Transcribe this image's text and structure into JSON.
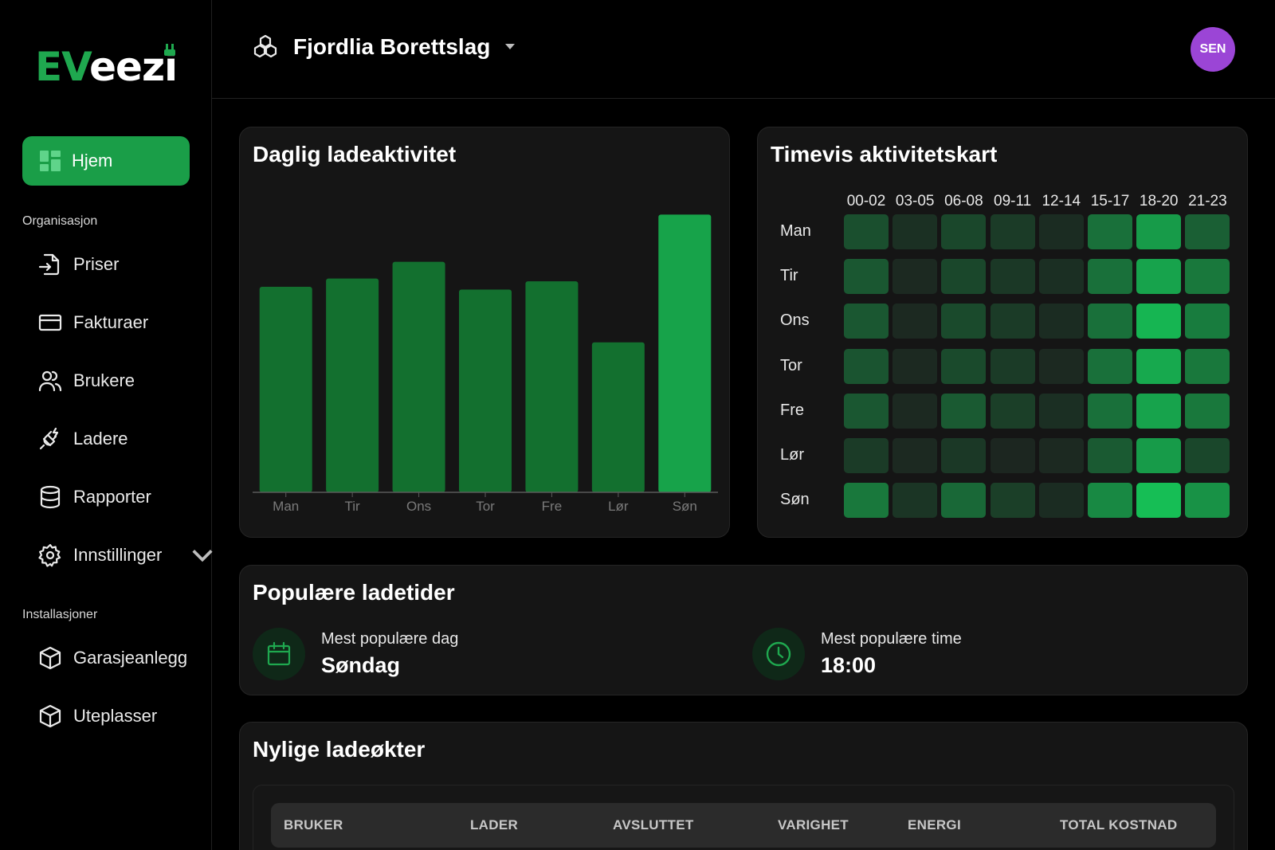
{
  "brand": {
    "logo_ev": "EV",
    "logo_eezi": "eezi",
    "accent": "#1a9e48"
  },
  "sidebar": {
    "home": {
      "label": "Hjem",
      "icon": "dashboard-icon"
    },
    "section_org": "Organisasjon",
    "org_items": [
      {
        "label": "Priser",
        "icon": "login-icon"
      },
      {
        "label": "Fakturaer",
        "icon": "credit-card-icon"
      },
      {
        "label": "Brukere",
        "icon": "users-icon"
      },
      {
        "label": "Ladere",
        "icon": "plug-icon"
      },
      {
        "label": "Rapporter",
        "icon": "database-icon"
      },
      {
        "label": "Innstillinger",
        "icon": "gear-icon"
      }
    ],
    "section_install": "Installasjoner",
    "install_items": [
      {
        "label": "Garasjeanlegg",
        "icon": "box-icon"
      },
      {
        "label": "Uteplasser",
        "icon": "box-icon"
      }
    ]
  },
  "header": {
    "org_name": "Fjordlia Borettslag",
    "avatar_initials": "SEN",
    "avatar_color": "#9b45d6"
  },
  "bar_card": {
    "title": "Daglig ladeaktivitet"
  },
  "chart_data": {
    "type": "bar",
    "categories": [
      "Man",
      "Tir",
      "Ons",
      "Tor",
      "Fre",
      "Lør",
      "Søn"
    ],
    "values": [
      74,
      77,
      83,
      73,
      76,
      54,
      100
    ],
    "ylim": [
      0,
      105
    ],
    "bar_color": "#13702f",
    "highlight_color": "#17a34a"
  },
  "heat_card": {
    "title": "Timevis aktivitetskart",
    "columns": [
      "00-02",
      "03-05",
      "06-08",
      "09-11",
      "12-14",
      "15-17",
      "18-20",
      "21-23"
    ],
    "rows": [
      "Man",
      "Tir",
      "Ons",
      "Tor",
      "Fre",
      "Lør",
      "Søn"
    ],
    "values": [
      [
        0.35,
        0.15,
        0.3,
        0.22,
        0.12,
        0.55,
        0.8,
        0.45
      ],
      [
        0.4,
        0.1,
        0.3,
        0.2,
        0.14,
        0.55,
        0.85,
        0.6
      ],
      [
        0.4,
        0.1,
        0.32,
        0.22,
        0.12,
        0.55,
        0.95,
        0.62
      ],
      [
        0.38,
        0.1,
        0.32,
        0.22,
        0.1,
        0.55,
        0.88,
        0.6
      ],
      [
        0.4,
        0.1,
        0.42,
        0.25,
        0.14,
        0.55,
        0.85,
        0.6
      ],
      [
        0.22,
        0.1,
        0.2,
        0.08,
        0.1,
        0.42,
        0.8,
        0.3
      ],
      [
        0.6,
        0.18,
        0.5,
        0.25,
        0.12,
        0.7,
        1.0,
        0.75
      ]
    ]
  },
  "pop_card": {
    "title": "Populære ladetider",
    "day_label": "Mest populære dag",
    "day_value": "Søndag",
    "hour_label": "Mest populære time",
    "hour_value": "18:00"
  },
  "recent_card": {
    "title": "Nylige ladeøkter",
    "columns": [
      "BRUKER",
      "LADER",
      "AVSLUTTET",
      "VARIGHET",
      "ENERGI",
      "TOTAL KOSTNAD"
    ]
  }
}
